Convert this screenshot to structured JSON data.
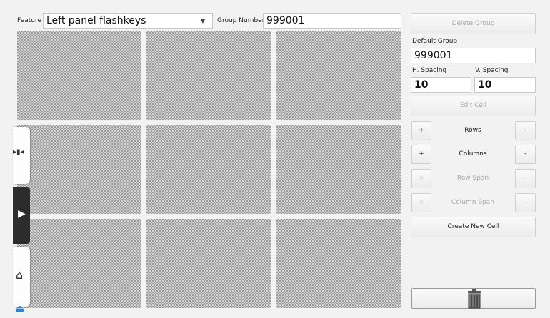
{
  "top": {
    "feature_label": "Feature",
    "feature_value": "Left panel flashkeys",
    "group_number_label": "Group Number",
    "group_number_value": "999001"
  },
  "panel": {
    "delete_group": "Delete Group",
    "default_group_label": "Default Group",
    "default_group_value": "999001",
    "h_spacing_label": "H. Spacing",
    "v_spacing_label": "V. Spacing",
    "h_spacing_value": "10",
    "v_spacing_value": "10",
    "edit_cell": "Edit Cell",
    "rows": [
      {
        "plus": "+",
        "label": "Rows",
        "minus": "-"
      },
      {
        "plus": "+",
        "label": "Columns",
        "minus": "-"
      },
      {
        "plus": "+",
        "label": "Row Span",
        "minus": "-"
      },
      {
        "plus": "+",
        "label": "Column Span",
        "minus": "-"
      }
    ],
    "create_new_cell": "Create New Cell"
  },
  "icons": {
    "side1": "expand-arrows-icon",
    "side2": "play-arrow-icon",
    "side3": "home-icon",
    "eject": "eject-icon",
    "trash": "trash-icon"
  }
}
